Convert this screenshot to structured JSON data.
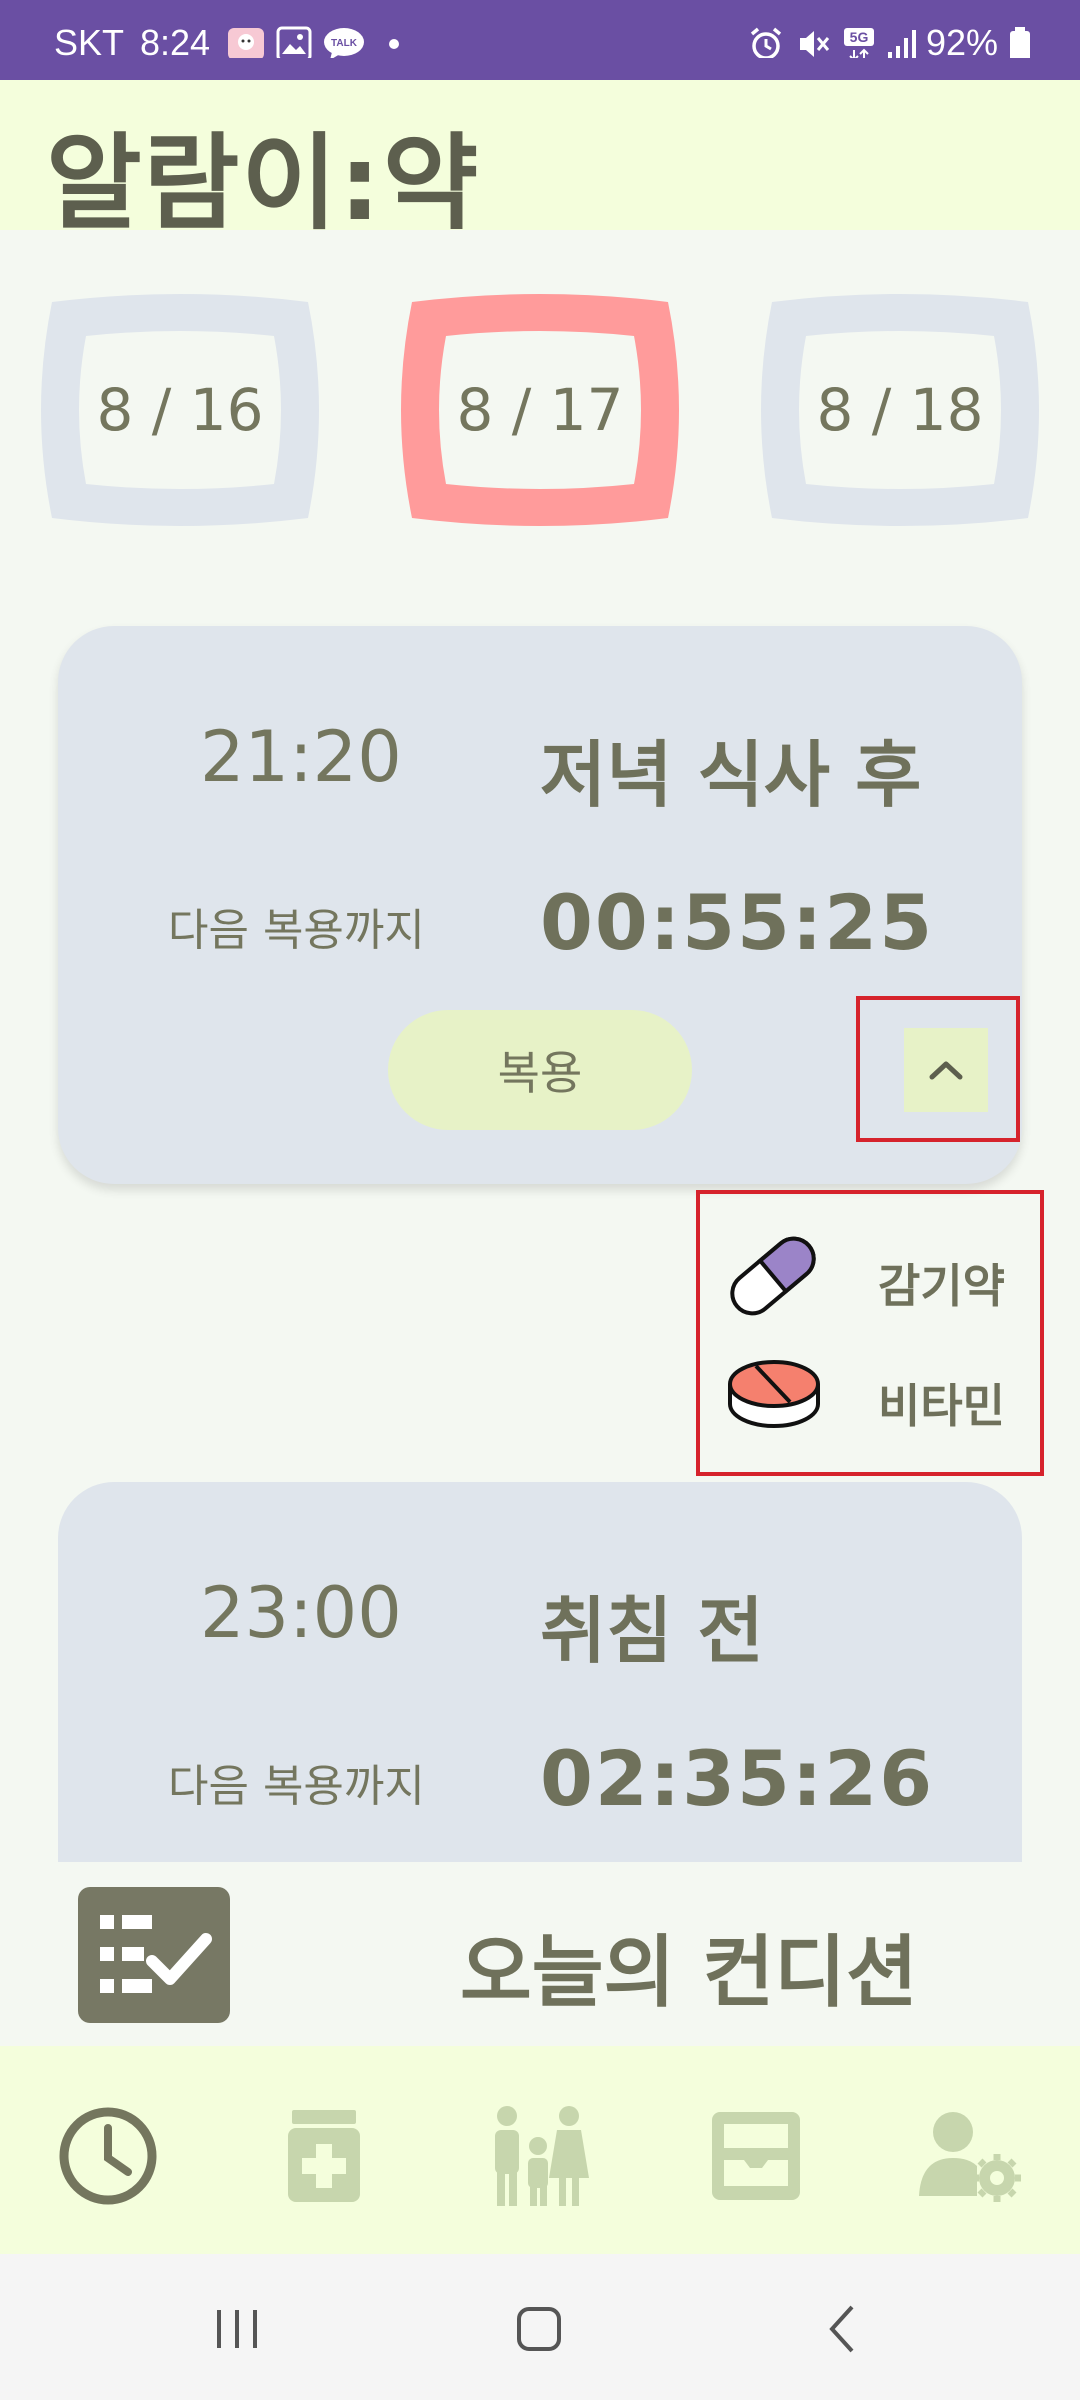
{
  "status_bar": {
    "carrier": "SKT",
    "time": "8:24",
    "battery": "92%",
    "network": "5G"
  },
  "header": {
    "title": "알람이:약"
  },
  "dates": [
    {
      "label": "8 / 16",
      "selected": false
    },
    {
      "label": "8 / 17",
      "selected": true
    },
    {
      "label": "8 / 18",
      "selected": false
    }
  ],
  "alarms": [
    {
      "time": "21:20",
      "meal": "저녁 식사 후",
      "next_label": "다음 복용까지",
      "countdown": "00:55:25",
      "take_label": "복용"
    },
    {
      "time": "23:00",
      "meal": "취침 전",
      "next_label": "다음 복용까지",
      "countdown": "02:35:26"
    }
  ],
  "medicines": [
    {
      "name": "감기약",
      "icon": "capsule-icon"
    },
    {
      "name": "비타민",
      "icon": "tablet-icon"
    }
  ],
  "condition": {
    "label": "오늘의 컨디션",
    "icon": "checklist-icon"
  },
  "nav": [
    {
      "name": "clock-icon",
      "active": true
    },
    {
      "name": "medicine-bottle-icon",
      "active": false
    },
    {
      "name": "family-icon",
      "active": false
    },
    {
      "name": "pill-case-icon",
      "active": false
    },
    {
      "name": "user-settings-icon",
      "active": false
    }
  ],
  "colors": {
    "status_bar": "#6a4fa3",
    "header_bg": "#f4fedc",
    "selected_date": "#ff9b9b",
    "unselected_date": "#dfe5ec",
    "card_bg": "#dfe5ec",
    "button_bg": "#e7f2c7",
    "text_dark": "#6f715b",
    "nav_active": "#74765e",
    "nav_inactive": "#c7d6ad",
    "highlight": "#d6232c"
  }
}
